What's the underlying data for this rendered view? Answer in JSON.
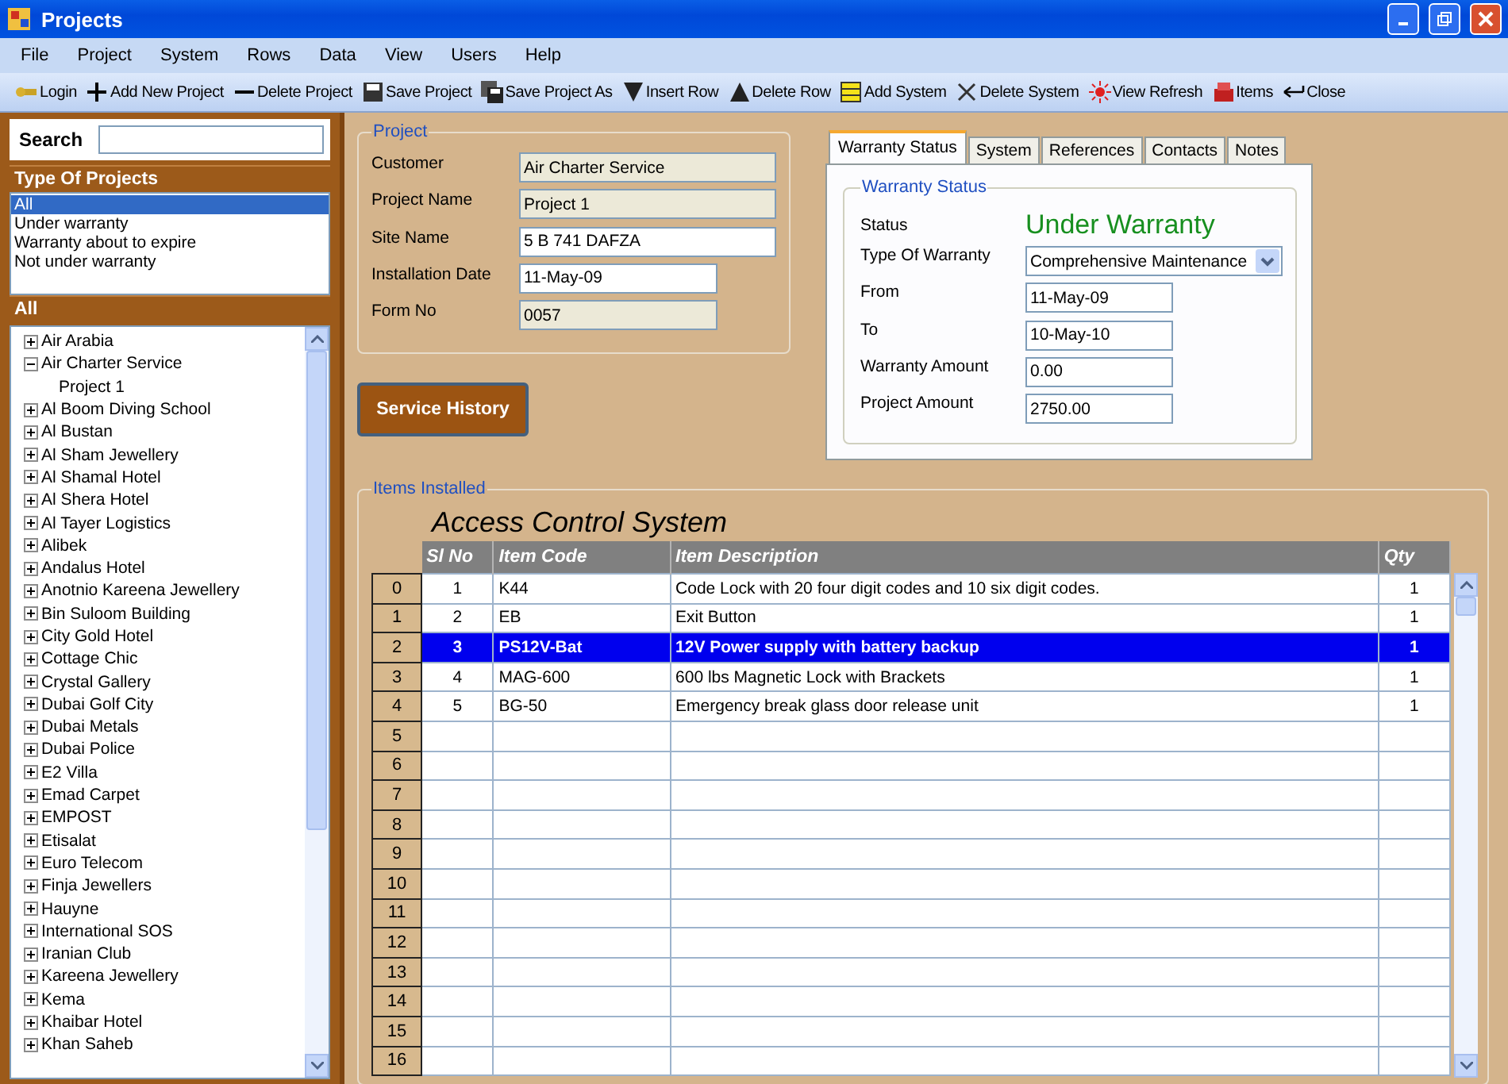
{
  "window": {
    "title": "Projects"
  },
  "menu": [
    "File",
    "Project",
    "System",
    "Rows",
    "Data",
    "View",
    "Users",
    "Help"
  ],
  "toolbar": [
    "Login",
    "Add New Project",
    "Delete Project",
    "Save Project",
    "Save Project As",
    "Insert Row",
    "Delete Row",
    "Add System",
    "Delete System",
    "View Refresh",
    "Items",
    "Close"
  ],
  "sidebar": {
    "search_label": "Search",
    "type_header": "Type Of Projects",
    "types": [
      {
        "label": "All",
        "selected": true
      },
      {
        "label": "Under warranty",
        "selected": false
      },
      {
        "label": "Warranty about to expire",
        "selected": false
      },
      {
        "label": "Not under warranty",
        "selected": false
      }
    ],
    "tree_header": "All",
    "tree": [
      {
        "label": "Air Arabia",
        "expanded": false
      },
      {
        "label": "Air Charter Service",
        "expanded": true,
        "children": [
          {
            "label": "Project 1"
          }
        ]
      },
      {
        "label": "Al Boom Diving School",
        "expanded": false
      },
      {
        "label": "Al Bustan",
        "expanded": false
      },
      {
        "label": "Al Sham Jewellery",
        "expanded": false
      },
      {
        "label": "Al Shamal Hotel",
        "expanded": false
      },
      {
        "label": "Al Shera Hotel",
        "expanded": false
      },
      {
        "label": "Al Tayer Logistics",
        "expanded": false
      },
      {
        "label": "Alibek",
        "expanded": false
      },
      {
        "label": "Andalus Hotel",
        "expanded": false
      },
      {
        "label": "Anotnio Kareena Jewellery",
        "expanded": false
      },
      {
        "label": "Bin Suloom Building",
        "expanded": false
      },
      {
        "label": "City Gold Hotel",
        "expanded": false
      },
      {
        "label": "Cottage Chic",
        "expanded": false
      },
      {
        "label": "Crystal Gallery",
        "expanded": false
      },
      {
        "label": "Dubai Golf City",
        "expanded": false
      },
      {
        "label": "Dubai Metals",
        "expanded": false
      },
      {
        "label": "Dubai Police",
        "expanded": false
      },
      {
        "label": "E2 Villa",
        "expanded": false
      },
      {
        "label": "Emad Carpet",
        "expanded": false
      },
      {
        "label": "EMPOST",
        "expanded": false
      },
      {
        "label": "Etisalat",
        "expanded": false
      },
      {
        "label": "Euro Telecom",
        "expanded": false
      },
      {
        "label": "Finja Jewellers",
        "expanded": false
      },
      {
        "label": "Hauyne",
        "expanded": false
      },
      {
        "label": "International SOS",
        "expanded": false
      },
      {
        "label": "Iranian Club",
        "expanded": false
      },
      {
        "label": "Kareena Jewellery",
        "expanded": false
      },
      {
        "label": "Kema",
        "expanded": false
      },
      {
        "label": "Khaibar Hotel",
        "expanded": false
      },
      {
        "label": "Khan Saheb",
        "expanded": false
      }
    ]
  },
  "project": {
    "legend": "Project",
    "fields": [
      {
        "label": "Customer",
        "value": "Air Charter Service",
        "disabled": true,
        "kind": "wide"
      },
      {
        "label": "Project Name",
        "value": "Project 1",
        "disabled": true,
        "kind": "wide"
      },
      {
        "label": "Site Name",
        "value": "5 B 741 DAFZA",
        "disabled": false,
        "kind": "wide"
      },
      {
        "label": "Installation Date",
        "value": "11-May-09",
        "disabled": false,
        "kind": "short"
      },
      {
        "label": "Form No",
        "value": "0057",
        "disabled": true,
        "kind": "short"
      }
    ]
  },
  "service_button": "Service History",
  "tabs": [
    {
      "label": "Warranty Status",
      "selected": true
    },
    {
      "label": "System",
      "selected": false
    },
    {
      "label": "References",
      "selected": false
    },
    {
      "label": "Contacts",
      "selected": false
    },
    {
      "label": "Notes",
      "selected": false
    }
  ],
  "warranty": {
    "legend": "Warranty Status",
    "status_label": "Status",
    "status": "Under Warranty",
    "fields": [
      {
        "label": "Type Of Warranty",
        "value": "Comprehensive Maintenance",
        "kind": "dropdown"
      },
      {
        "label": "From",
        "value": "11-May-09",
        "kind": "text"
      },
      {
        "label": "To",
        "value": "10-May-10",
        "kind": "text"
      },
      {
        "label": "Warranty Amount",
        "value": "0.00",
        "kind": "text"
      },
      {
        "label": "Project Amount",
        "value": "2750.00",
        "kind": "text"
      }
    ]
  },
  "items": {
    "legend": "Items Installed",
    "system": "Access Control System",
    "columns": [
      "Sl No",
      "Item Code",
      "Item Description",
      "Qty"
    ],
    "rows": [
      {
        "header": "0",
        "cells": [
          "1",
          "K44",
          "Code Lock with 20 four digit codes and 10 six digit codes.",
          "1"
        ],
        "selected": false
      },
      {
        "header": "1",
        "cells": [
          "2",
          "EB",
          "Exit Button",
          "1"
        ],
        "selected": false
      },
      {
        "header": "2",
        "cells": [
          "3",
          "PS12V-Bat",
          "12V Power supply with battery backup",
          "1"
        ],
        "selected": true
      },
      {
        "header": "3",
        "cells": [
          "4",
          "MAG-600",
          "600 lbs Magnetic Lock with Brackets",
          "1"
        ],
        "selected": false
      },
      {
        "header": "4",
        "cells": [
          "5",
          "BG-50",
          "Emergency break glass door release unit",
          "1"
        ],
        "selected": false
      },
      {
        "header": "5",
        "selected": false
      },
      {
        "header": "6",
        "selected": false
      },
      {
        "header": "7",
        "selected": false
      },
      {
        "header": "8",
        "selected": false
      },
      {
        "header": "9",
        "selected": false
      },
      {
        "header": "10",
        "selected": false
      },
      {
        "header": "11",
        "selected": false
      },
      {
        "header": "12",
        "selected": false
      },
      {
        "header": "13",
        "selected": false
      },
      {
        "header": "14",
        "selected": false
      },
      {
        "header": "15",
        "selected": false
      },
      {
        "header": "16",
        "selected": false
      }
    ]
  }
}
